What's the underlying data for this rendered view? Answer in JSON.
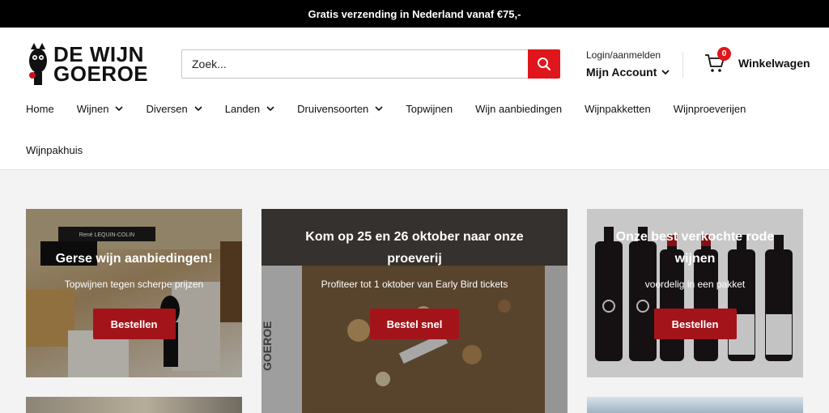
{
  "announcement": "Gratis verzending in Nederland vanaf €75,-",
  "logo": {
    "line1": "DE WIJN",
    "line2": "GOEROE"
  },
  "search": {
    "placeholder": "Zoek..."
  },
  "account": {
    "login": "Login/aanmelden",
    "account": "Mijn Account"
  },
  "cart": {
    "count": "0",
    "label": "Winkelwagen"
  },
  "nav": {
    "row1": [
      {
        "label": "Home"
      },
      {
        "label": "Wijnen"
      },
      {
        "label": "Diversen"
      },
      {
        "label": "Landen"
      },
      {
        "label": "Druivensoorten"
      },
      {
        "label": "Topwijnen"
      },
      {
        "label": "Wijn aanbiedingen"
      },
      {
        "label": "Wijnpakketten"
      },
      {
        "label": "Wijnproeverijen"
      }
    ],
    "row2": [
      {
        "label": "Wijnpakhuis"
      }
    ]
  },
  "cards": [
    {
      "title": "Gerse wijn aanbiedingen!",
      "subtitle": "Topwijnen tegen scherpe prijzen",
      "button": "Bestellen",
      "image_text": "René LEQUIN-COLIN"
    },
    {
      "title": "Kom op 25 en 26 oktober naar onze proeverij",
      "subtitle": "Profiteer tot 1 oktober van Early Bird tickets",
      "button": "Bestel snel",
      "image_text": "GOEROE"
    },
    {
      "title": "Onze best verkochte rode wijnen",
      "subtitle": "voordelig in een pakket",
      "button": "Bestellen"
    }
  ],
  "colors": {
    "accent": "#e0161d",
    "button": "#a3141a",
    "announcement_bg": "#000000"
  }
}
